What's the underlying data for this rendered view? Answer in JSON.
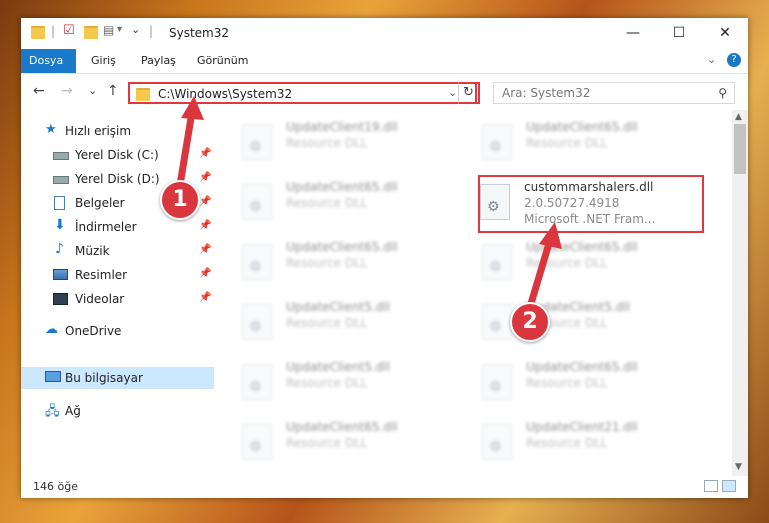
{
  "window": {
    "title": "System32",
    "controls": {
      "minimize": "—",
      "maximize": "☐",
      "close": "✕"
    }
  },
  "ribbon": {
    "tabs": [
      {
        "label": "Dosya",
        "active": true
      },
      {
        "label": "Giriş",
        "active": false
      },
      {
        "label": "Paylaş",
        "active": false
      },
      {
        "label": "Görünüm",
        "active": false
      }
    ],
    "expand_icon": "⌄",
    "help_icon": "?"
  },
  "navigation": {
    "back": "←",
    "forward": "→",
    "recent": "⌄",
    "up": "↑",
    "address": "C:\\Windows\\System32",
    "address_dropdown": "⌄",
    "refresh": "↻",
    "search_placeholder": "Ara: System32",
    "search_icon": "⚲"
  },
  "sidebar": {
    "items": [
      {
        "label": "Hızlı erişim",
        "icon": "star-icon",
        "pinned": false
      },
      {
        "label": "Yerel Disk (C:)",
        "icon": "drive-icon",
        "pinned": true
      },
      {
        "label": "Yerel Disk (D:)",
        "icon": "drive-icon",
        "pinned": true
      },
      {
        "label": "Belgeler",
        "icon": "documents-icon",
        "pinned": true
      },
      {
        "label": "İndirmeler",
        "icon": "downloads-icon",
        "pinned": true
      },
      {
        "label": "Müzik",
        "icon": "music-icon",
        "pinned": true
      },
      {
        "label": "Resimler",
        "icon": "pictures-icon",
        "pinned": true
      },
      {
        "label": "Videolar",
        "icon": "videos-icon",
        "pinned": true
      },
      {
        "label": "OneDrive",
        "icon": "cloud-icon",
        "pinned": false
      },
      {
        "label": "Bu bilgisayar",
        "icon": "computer-icon",
        "pinned": false,
        "selected": true
      },
      {
        "label": "Ağ",
        "icon": "network-icon",
        "pinned": false
      }
    ],
    "pin_glyph": "📌"
  },
  "files": [
    {
      "name": "UpdateClient19.dll",
      "line2": "Resource DLL",
      "line3": "",
      "blurred": true
    },
    {
      "name": "UpdateClient65.dll",
      "line2": "Resource DLL",
      "line3": "",
      "blurred": true
    },
    {
      "name": "UpdateClient65.dll",
      "line2": "Resource DLL",
      "line3": "",
      "blurred": true
    },
    {
      "name": "custommarshalers.dll",
      "line2": "2.0.50727.4918",
      "line3": "Microsoft .NET Fram...",
      "blurred": false
    },
    {
      "name": "UpdateClient65.dll",
      "line2": "Resource DLL",
      "line3": "",
      "blurred": true
    },
    {
      "name": "UpdateClient65.dll",
      "line2": "Resource DLL",
      "line3": "",
      "blurred": true
    },
    {
      "name": "UpdateClient5.dll",
      "line2": "Resource DLL",
      "line3": "",
      "blurred": true
    },
    {
      "name": "UpdateClient5.dll",
      "line2": "Resource DLL",
      "line3": "",
      "blurred": true
    },
    {
      "name": "UpdateClient5.dll",
      "line2": "Resource DLL",
      "line3": "",
      "blurred": true
    },
    {
      "name": "UpdateClient65.dll",
      "line2": "Resource DLL",
      "line3": "",
      "blurred": true
    },
    {
      "name": "UpdateClient65.dll",
      "line2": "Resource DLL",
      "line3": "",
      "blurred": true
    },
    {
      "name": "UpdateClient21.dll",
      "line2": "Resource DLL",
      "line3": "",
      "blurred": true
    }
  ],
  "status": {
    "item_count": "146 öğe"
  },
  "annotations": {
    "step1": "1",
    "step2": "2",
    "highlight_color": "#e0383e"
  },
  "colors": {
    "accent": "#1979ca",
    "selected": "#cce8ff",
    "annotation": "#d9363e"
  }
}
